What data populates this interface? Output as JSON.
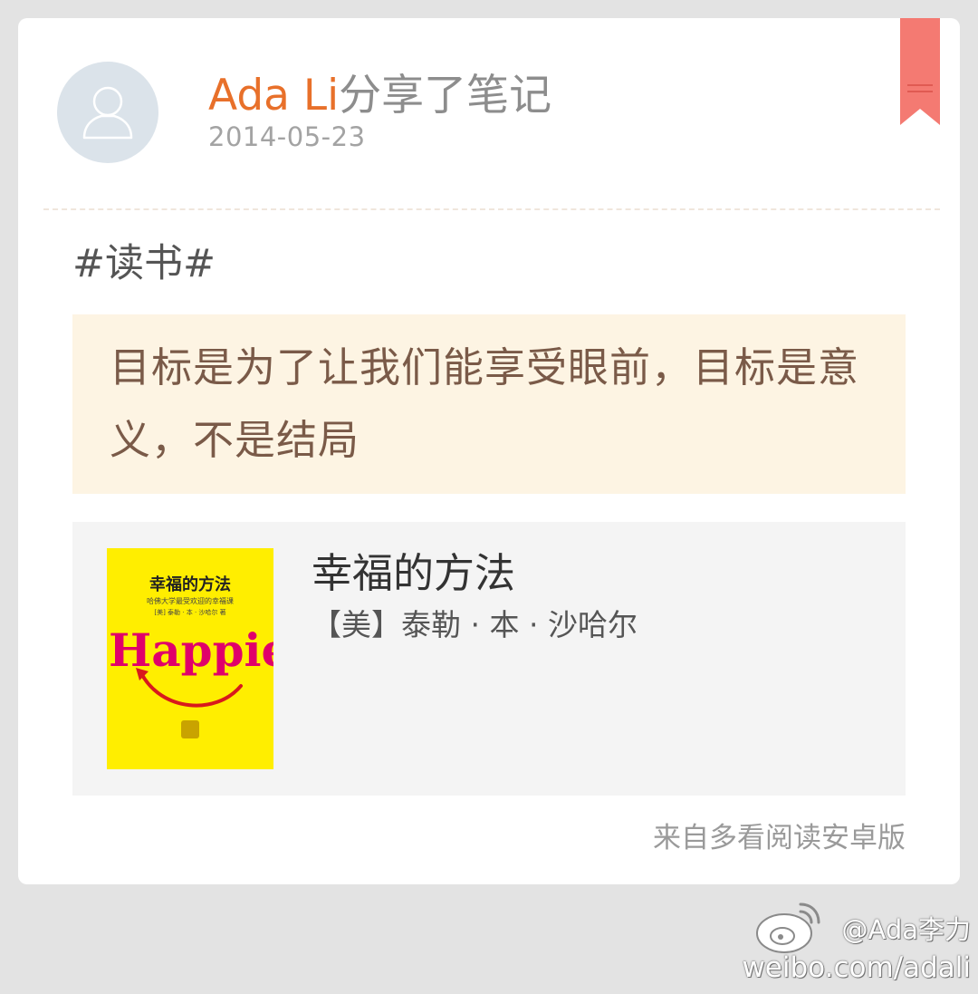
{
  "post": {
    "user_name": "Ada Li",
    "action": "分享了笔记",
    "date": "2014-05-23",
    "tag": "#读书#",
    "quote": "目标是为了让我们能享受眼前，目标是意义，不是结局"
  },
  "book": {
    "title": "幸福的方法",
    "author": "【美】泰勒 · 本 · 沙哈尔",
    "cover": {
      "title": "幸福的方法",
      "subtitle": "哈佛大学最受欢迎的幸福课",
      "author": "[美] 泰勒 · 本 · 沙哈尔 著",
      "art_word": "Happier"
    }
  },
  "footer": {
    "source": "来自多看阅读安卓版"
  },
  "watermark": {
    "handle": "@Ada李力",
    "url": "weibo.com/adali"
  },
  "colors": {
    "background": "#e3e3e3",
    "card": "#ffffff",
    "user_name": "#e8702a",
    "quote_bg": "#fdf4e3",
    "quote_text": "#7a5a48",
    "book_bg": "#f4f4f4",
    "bookmark": "#f47a72",
    "cover": "#ffee00"
  },
  "icons": {
    "avatar": "default-avatar-icon",
    "bookmark": "bookmark-ribbon-icon",
    "watermark_logo": "weibo-logo-icon"
  }
}
